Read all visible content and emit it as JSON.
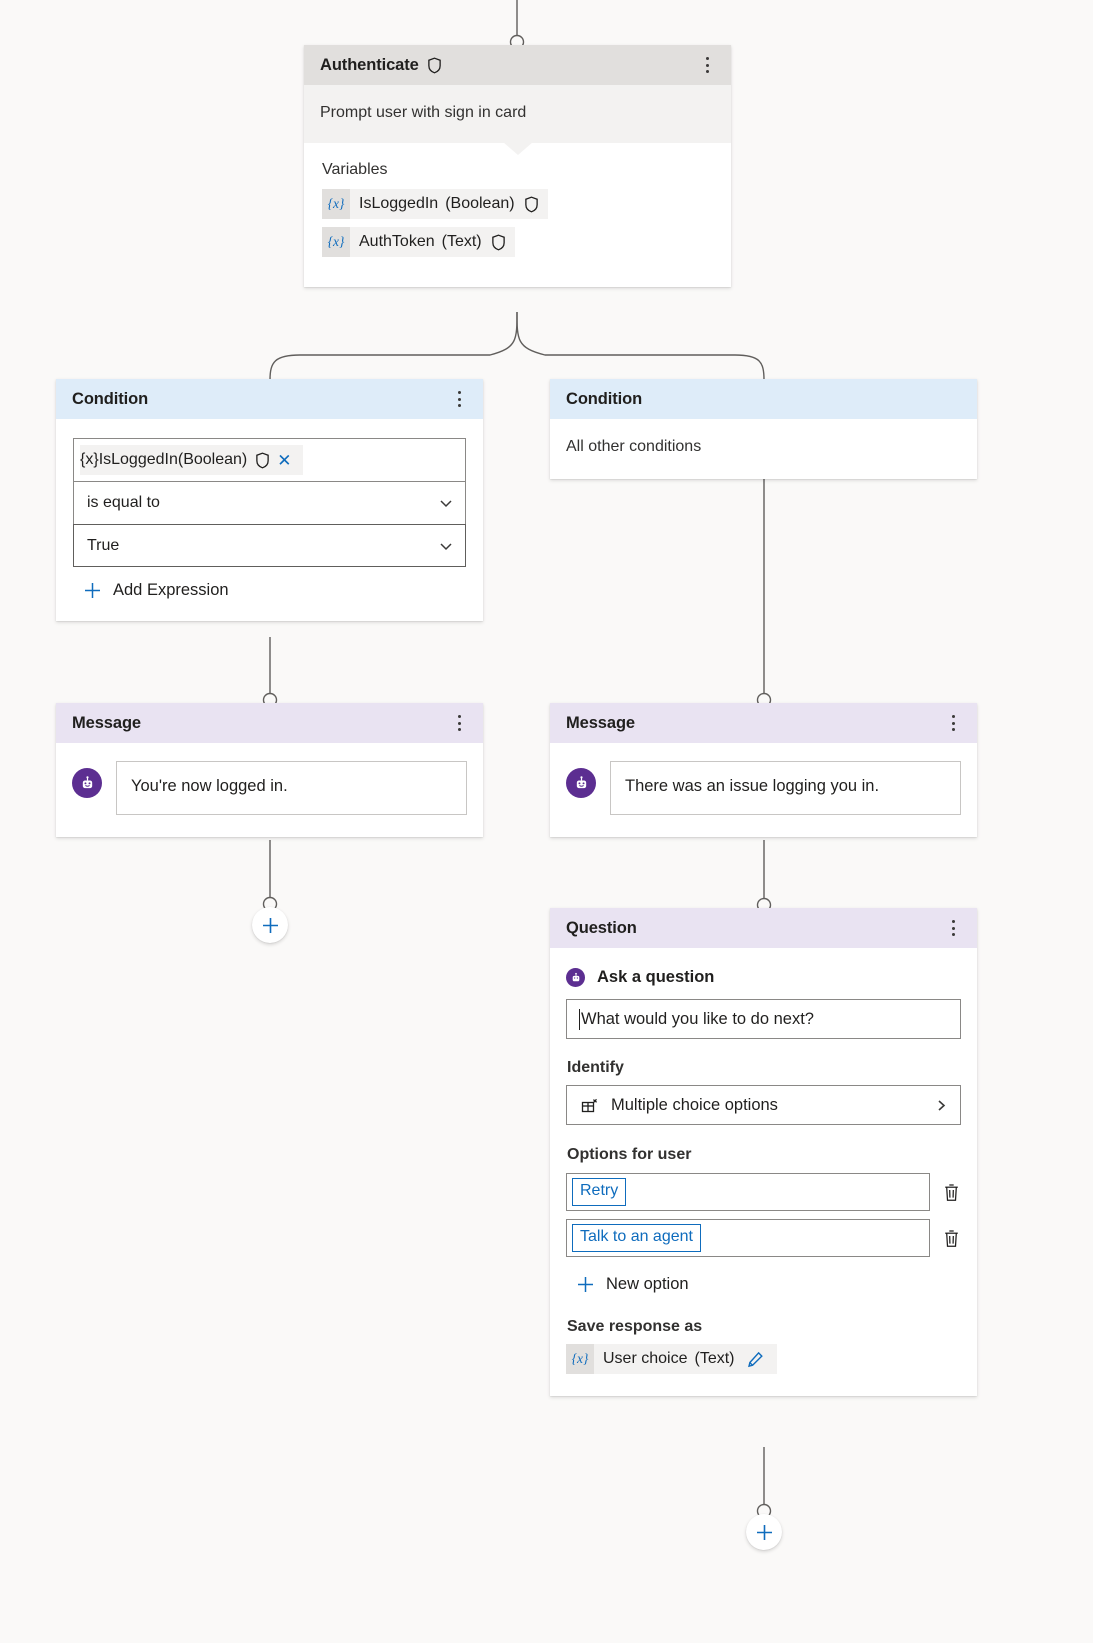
{
  "canvas": {
    "background_color": "#faf9f8",
    "edge_color": "#605e5c"
  },
  "nodes": {
    "authenticate": {
      "title": "Authenticate",
      "header_icon": "shield-icon",
      "subtitle": "Prompt user with sign in card",
      "variables_label": "Variables",
      "variables": [
        {
          "tag": "{x}",
          "name": "IsLoggedIn",
          "type": "(Boolean)",
          "secured": true
        },
        {
          "tag": "{x}",
          "name": "AuthToken",
          "type": "(Text)",
          "secured": true
        }
      ],
      "menu_icon": "kebab-menu-icon"
    },
    "condition_true": {
      "title": "Condition",
      "menu_icon": "kebab-menu-icon",
      "variable": {
        "tag": "{x}",
        "name": "IsLoggedIn",
        "type": "(Boolean)",
        "secured": true,
        "remove_icon": "close-icon"
      },
      "operator": "is equal to",
      "value": "True",
      "add_expression_label": "Add Expression"
    },
    "condition_else": {
      "title": "Condition",
      "description": "All other conditions"
    },
    "message_success": {
      "title": "Message",
      "menu_icon": "kebab-menu-icon",
      "avatar_icon": "bot-icon",
      "text": "You're now logged in."
    },
    "message_failure": {
      "title": "Message",
      "menu_icon": "kebab-menu-icon",
      "avatar_icon": "bot-icon",
      "text": "There was an issue logging you in."
    },
    "question": {
      "title": "Question",
      "menu_icon": "kebab-menu-icon",
      "ask_icon": "bot-icon",
      "ask_label": "Ask a question",
      "question_text": "What would you like to do next?",
      "identify_label": "Identify",
      "identify_value": "Multiple choice options",
      "identify_icon": "multiple-choice-icon",
      "identify_chevron": "chevron-right-icon",
      "options_label": "Options for user",
      "options": [
        {
          "label": "Retry",
          "delete_icon": "trash-icon"
        },
        {
          "label": "Talk to an agent",
          "delete_icon": "trash-icon"
        }
      ],
      "new_option_label": "New option",
      "save_response_label": "Save response as",
      "save_variable": {
        "tag": "{x}",
        "name": "User choice",
        "type": "(Text)",
        "edit_icon": "pencil-icon"
      }
    }
  },
  "add_buttons": [
    {
      "name": "add-node-button-left",
      "icon": "plus-icon"
    },
    {
      "name": "add-node-button-bottom",
      "icon": "plus-icon"
    }
  ]
}
